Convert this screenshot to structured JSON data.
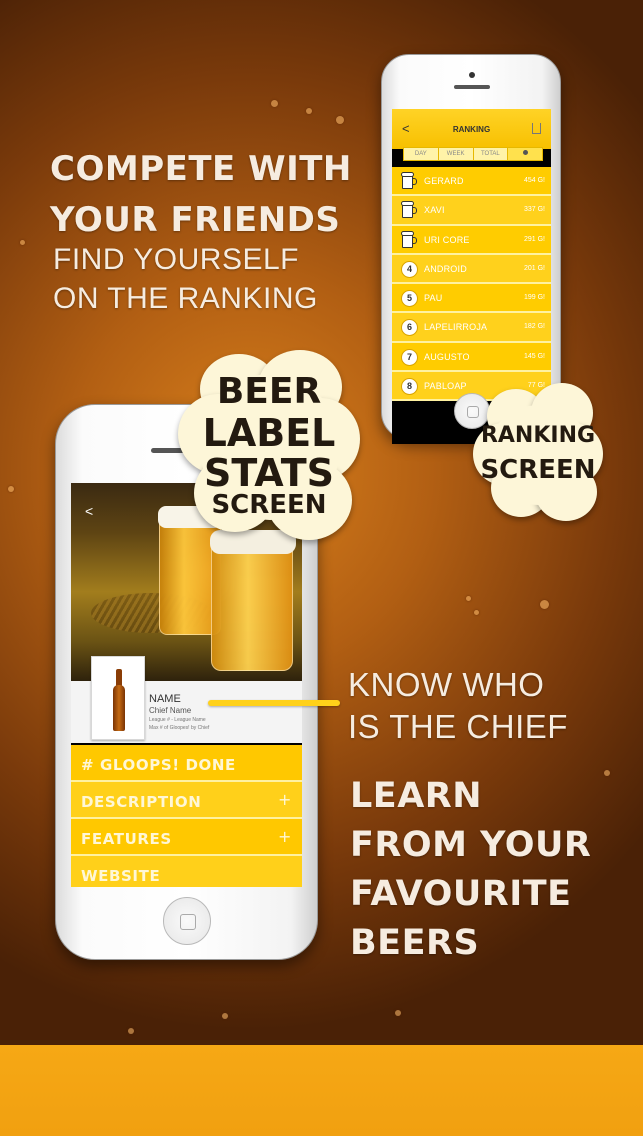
{
  "headline_top": {
    "bold_line1": "COMPETE WITH",
    "bold_line2": "YOUR FRIENDS",
    "light_line1": "FIND YOURSELF",
    "light_line2": "ON THE RANKING"
  },
  "cloud_stats": {
    "line1": "BEER",
    "line2": "LABEL",
    "line3": "STATS",
    "line4": "SCREEN"
  },
  "cloud_ranking": {
    "line1": "RANKING",
    "line2": "SCREEN"
  },
  "headline_chief": {
    "line1": "KNOW WHO",
    "line2": "IS THE CHIEF"
  },
  "headline_learn": {
    "line1": "LEARN",
    "line2": "FROM YOUR",
    "line3": "FAVOURITE",
    "line4": "BEERS"
  },
  "ranking_screen": {
    "back": "<",
    "title": "RANKING",
    "tabs": [
      "DAY",
      "WEEK",
      "TOTAL"
    ],
    "rows": [
      {
        "rank": "",
        "icon": "beer-mug-icon",
        "name": "GERARD",
        "score": "454 G!"
      },
      {
        "rank": "",
        "icon": "beer-mug-icon",
        "name": "XAVI",
        "score": "337 G!"
      },
      {
        "rank": "",
        "icon": "beer-mug-icon",
        "name": "URI CORE",
        "score": "291 G!"
      },
      {
        "rank": "4",
        "icon": "",
        "name": "ANDROID",
        "score": "201 G!"
      },
      {
        "rank": "5",
        "icon": "",
        "name": "PAU",
        "score": "199 G!"
      },
      {
        "rank": "6",
        "icon": "",
        "name": "LAPELIRROJA",
        "score": "182 G!"
      },
      {
        "rank": "7",
        "icon": "",
        "name": "AUGUSTO",
        "score": "145 G!"
      },
      {
        "rank": "8",
        "icon": "",
        "name": "PABLOAP",
        "score": "77 G!"
      }
    ]
  },
  "stats_screen": {
    "back": "<",
    "name": "NAME",
    "chief": "Chief Name",
    "league": "League # - League Name",
    "max": "Max # of Gloopes! by Chief",
    "rows": [
      {
        "label": "# GLOOPS! DONE",
        "plus": ""
      },
      {
        "label": "DESCRIPTION",
        "plus": "+"
      },
      {
        "label": "FEATURES",
        "plus": "+"
      },
      {
        "label": "WEBSITE",
        "plus": ""
      }
    ]
  },
  "colors": {
    "accent_yellow": "#ffcc00",
    "bottom_bar": "#f4a412",
    "text_light": "#f6ece0"
  }
}
